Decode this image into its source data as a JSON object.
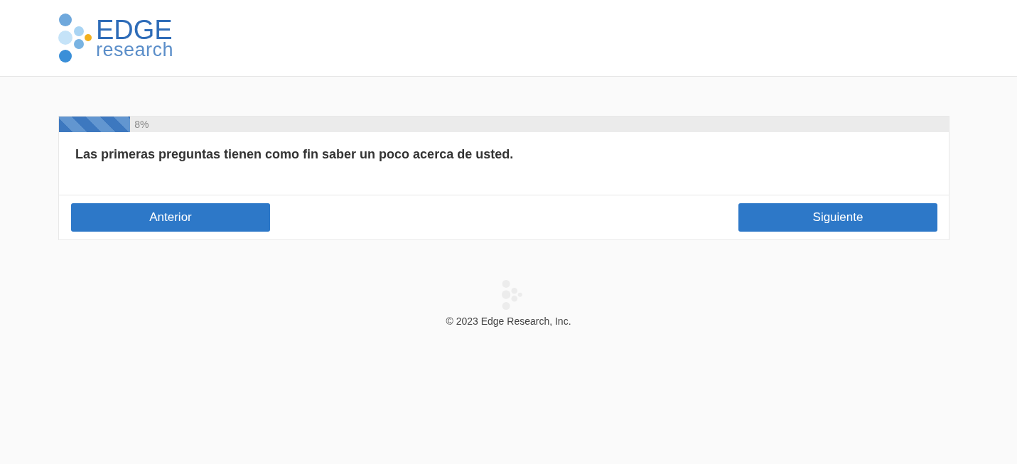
{
  "logo": {
    "word": "EDGE",
    "subword": "research"
  },
  "progress": {
    "level": 0.08,
    "reading": "8%"
  },
  "question": {
    "text": "Las primeras preguntas tienen como fin saber un poco acerca de usted."
  },
  "buttons": [
    {
      "label": "Anterior"
    },
    {
      "label": "Siguiente"
    }
  ],
  "footer": {
    "copyright": "© 2023 Edge Research, Inc."
  }
}
